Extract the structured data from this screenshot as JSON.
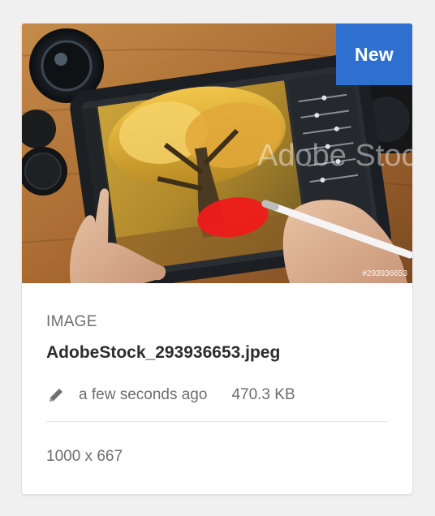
{
  "card": {
    "badge": "New",
    "thumbnail_alt": "Tablet photo editing with stylus",
    "stock_id": "#293936653",
    "watermark": "Adobe Stock",
    "type_label": "IMAGE",
    "filename": "AdobeStock_293936653.jpeg",
    "modified": "a few seconds ago",
    "size": "470.3 KB",
    "dimensions": "1000 x 667",
    "icons": {
      "edit": "pencil-icon"
    },
    "colors": {
      "badge": "#2f6fcf",
      "text_secondary": "#6e6e6e",
      "text_primary": "#2c2c2c"
    }
  }
}
